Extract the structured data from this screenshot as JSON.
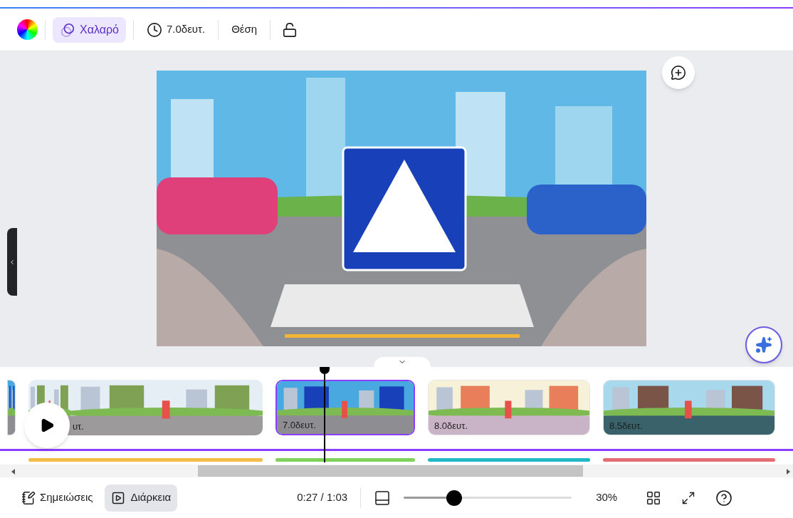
{
  "toolbar": {
    "animation": {
      "label": "Χαλαρό",
      "selected": true
    },
    "duration": "7.0δευτ.",
    "position": "Θέση"
  },
  "timeline": {
    "clips": [
      {
        "label": "υτ.",
        "selected": false,
        "color": "#f2bc48",
        "kind": "street"
      },
      {
        "label": "7.0δευτ.",
        "selected": true,
        "color": "#7ed15a",
        "kind": "crossing"
      },
      {
        "label": "8.0δευτ.",
        "selected": false,
        "color": "#20b8c4",
        "kind": "school"
      },
      {
        "label": "8.5δευτ.",
        "selected": false,
        "color": "#e36d73",
        "kind": "houses"
      }
    ]
  },
  "bottom_bar": {
    "notes": {
      "label": "Σημειώσεις",
      "selected": false
    },
    "duration": {
      "label": "Διάρκεια",
      "selected": true
    },
    "time": "0:27 / 1:03",
    "zoom": {
      "level": 0.3,
      "reading": "30%"
    }
  }
}
